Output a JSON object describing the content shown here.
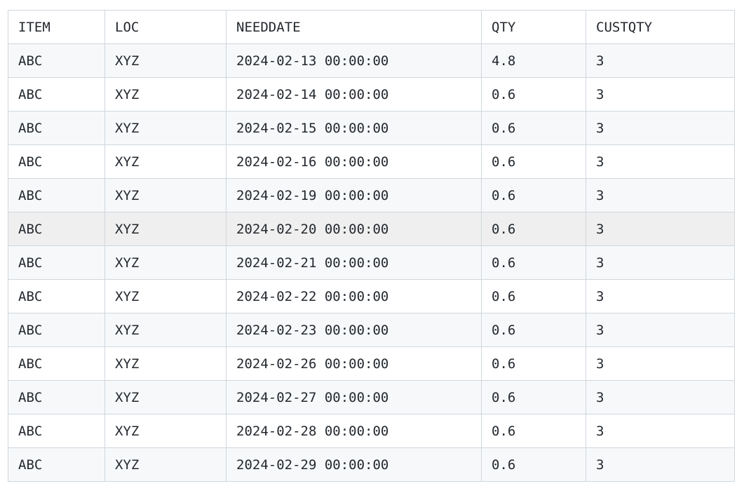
{
  "table": {
    "columns": [
      "ITEM",
      "LOC",
      "NEEDDATE",
      "QTY",
      "CUSTQTY"
    ],
    "rows": [
      [
        "ABC",
        "XYZ",
        "2024-02-13 00:00:00",
        "4.8",
        "3"
      ],
      [
        "ABC",
        "XYZ",
        "2024-02-14 00:00:00",
        "0.6",
        "3"
      ],
      [
        "ABC",
        "XYZ",
        "2024-02-15 00:00:00",
        "0.6",
        "3"
      ],
      [
        "ABC",
        "XYZ",
        "2024-02-16 00:00:00",
        "0.6",
        "3"
      ],
      [
        "ABC",
        "XYZ",
        "2024-02-19 00:00:00",
        "0.6",
        "3"
      ],
      [
        "ABC",
        "XYZ",
        "2024-02-20 00:00:00",
        "0.6",
        "3"
      ],
      [
        "ABC",
        "XYZ",
        "2024-02-21 00:00:00",
        "0.6",
        "3"
      ],
      [
        "ABC",
        "XYZ",
        "2024-02-22 00:00:00",
        "0.6",
        "3"
      ],
      [
        "ABC",
        "XYZ",
        "2024-02-23 00:00:00",
        "0.6",
        "3"
      ],
      [
        "ABC",
        "XYZ",
        "2024-02-26 00:00:00",
        "0.6",
        "3"
      ],
      [
        "ABC",
        "XYZ",
        "2024-02-27 00:00:00",
        "0.6",
        "3"
      ],
      [
        "ABC",
        "XYZ",
        "2024-02-28 00:00:00",
        "0.6",
        "3"
      ],
      [
        "ABC",
        "XYZ",
        "2024-02-29 00:00:00",
        "0.6",
        "3"
      ]
    ],
    "highlighted_row": 5
  }
}
